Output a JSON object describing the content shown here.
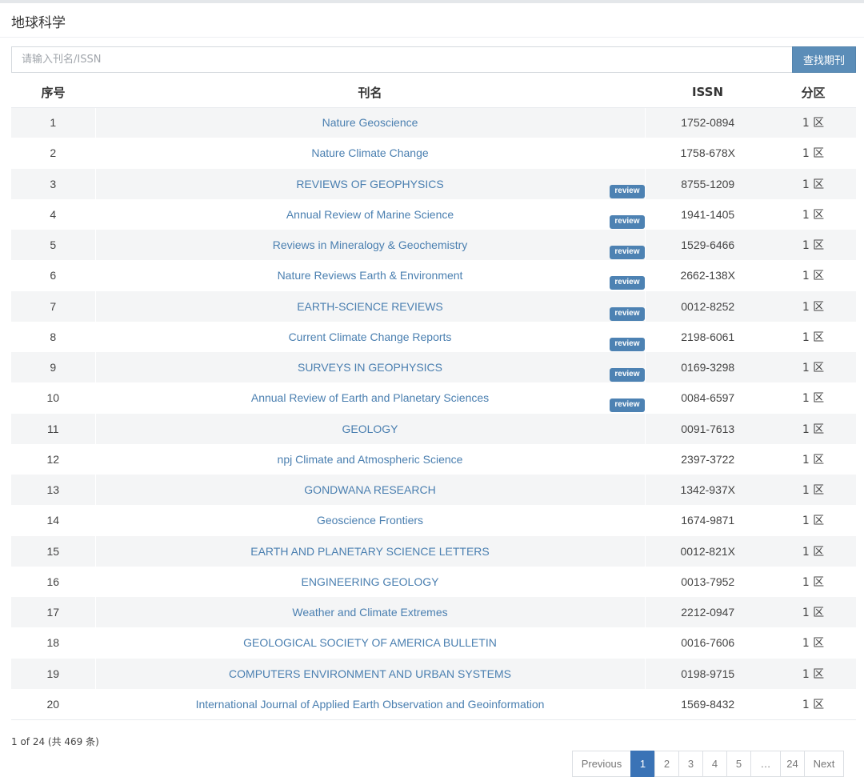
{
  "header": {
    "title": "地球科学"
  },
  "search": {
    "placeholder": "请输入刊名/ISSN",
    "button_label": "查找期刊"
  },
  "table": {
    "columns": [
      "序号",
      "刊名",
      "ISSN",
      "分区"
    ],
    "rows": [
      {
        "no": "1",
        "name": "Nature Geoscience",
        "issn": "1752-0894",
        "zone": "1 区",
        "review": null
      },
      {
        "no": "2",
        "name": "Nature Climate Change",
        "issn": "1758-678X",
        "zone": "1 区",
        "review": null
      },
      {
        "no": "3",
        "name": "REVIEWS OF GEOPHYSICS",
        "issn": "8755-1209",
        "zone": "1 区",
        "review": "review"
      },
      {
        "no": "4",
        "name": "Annual Review of Marine Science",
        "issn": "1941-1405",
        "zone": "1 区",
        "review": "review"
      },
      {
        "no": "5",
        "name": "Reviews in Mineralogy & Geochemistry",
        "issn": "1529-6466",
        "zone": "1 区",
        "review": "review"
      },
      {
        "no": "6",
        "name": "Nature Reviews Earth & Environment",
        "issn": "2662-138X",
        "zone": "1 区",
        "review": "review"
      },
      {
        "no": "7",
        "name": "EARTH-SCIENCE REVIEWS",
        "issn": "0012-8252",
        "zone": "1 区",
        "review": "review"
      },
      {
        "no": "8",
        "name": "Current Climate Change Reports",
        "issn": "2198-6061",
        "zone": "1 区",
        "review": "review"
      },
      {
        "no": "9",
        "name": "SURVEYS IN GEOPHYSICS",
        "issn": "0169-3298",
        "zone": "1 区",
        "review": "review"
      },
      {
        "no": "10",
        "name": "Annual Review of Earth and Planetary Sciences",
        "issn": "0084-6597",
        "zone": "1 区",
        "review": "review"
      },
      {
        "no": "11",
        "name": "GEOLOGY",
        "issn": "0091-7613",
        "zone": "1 区",
        "review": null
      },
      {
        "no": "12",
        "name": "npj Climate and Atmospheric Science",
        "issn": "2397-3722",
        "zone": "1 区",
        "review": null
      },
      {
        "no": "13",
        "name": "GONDWANA RESEARCH",
        "issn": "1342-937X",
        "zone": "1 区",
        "review": null
      },
      {
        "no": "14",
        "name": "Geoscience Frontiers",
        "issn": "1674-9871",
        "zone": "1 区",
        "review": null
      },
      {
        "no": "15",
        "name": "EARTH AND PLANETARY SCIENCE LETTERS",
        "issn": "0012-821X",
        "zone": "1 区",
        "review": null
      },
      {
        "no": "16",
        "name": "ENGINEERING GEOLOGY",
        "issn": "0013-7952",
        "zone": "1 区",
        "review": null
      },
      {
        "no": "17",
        "name": "Weather and Climate Extremes",
        "issn": "2212-0947",
        "zone": "1 区",
        "review": null
      },
      {
        "no": "18",
        "name": "GEOLOGICAL SOCIETY OF AMERICA BULLETIN",
        "issn": "0016-7606",
        "zone": "1 区",
        "review": null
      },
      {
        "no": "19",
        "name": "COMPUTERS ENVIRONMENT AND URBAN SYSTEMS",
        "issn": "0198-9715",
        "zone": "1 区",
        "review": null
      },
      {
        "no": "20",
        "name": "International Journal of Applied Earth Observation and Geoinformation",
        "issn": "1569-8432",
        "zone": "1 区",
        "review": null
      }
    ]
  },
  "pager": {
    "info": "1 of 24 (共 469 条)",
    "previous": "Previous",
    "next": "Next",
    "pages": [
      "1",
      "2",
      "3",
      "4",
      "5"
    ],
    "ellipsis": "…",
    "last": "24",
    "current": "1"
  },
  "colors": {
    "link": "#4a7fb0",
    "badge": "#4d82b3",
    "button": "#5b8db8",
    "active_page": "#3a73b6",
    "stripe": "#f4f5f6"
  }
}
